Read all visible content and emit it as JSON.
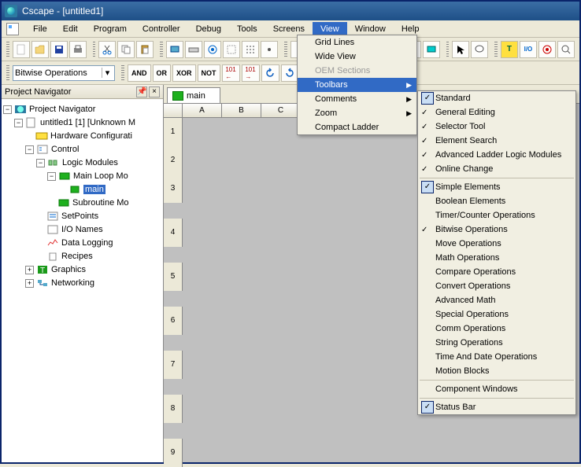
{
  "window_title": "Cscape - [untitled1]",
  "menubar": [
    "File",
    "Edit",
    "Program",
    "Controller",
    "Debug",
    "Tools",
    "Screens",
    "View",
    "Window",
    "Help"
  ],
  "active_menu": "View",
  "toolbar2_combo": "Bitwise Operations",
  "toolbar2_txtbtns": [
    "AND",
    "OR",
    "XOR",
    "NOT"
  ],
  "navigator_title": "Project Navigator",
  "tree": {
    "root": "Project Navigator",
    "project": "untitled1 [1] [Unknown M",
    "hw": "Hardware Configurati",
    "control": "Control",
    "logic": "Logic Modules",
    "mainloop": "Main Loop Mo",
    "main": "main",
    "subroutine": "Subroutine Mo",
    "setpoints": "SetPoints",
    "ionames": "I/O Names",
    "datalog": "Data Logging",
    "recipes": "Recipes",
    "graphics": "Graphics",
    "networking": "Networking"
  },
  "tab_label": "main",
  "col_labels": [
    "A",
    "B",
    "C"
  ],
  "row_nums": [
    "1",
    "2",
    "3",
    "4",
    "5",
    "6",
    "7",
    "8",
    "9"
  ],
  "view_menu_items": [
    {
      "label": "Grid Lines"
    },
    {
      "label": "Wide View"
    },
    {
      "label": "OEM Sections",
      "disabled": true
    },
    {
      "label": "Toolbars",
      "submenu": true,
      "highlight": true
    },
    {
      "label": "Comments",
      "submenu": true
    },
    {
      "label": "Zoom",
      "submenu": true
    },
    {
      "label": "Compact Ladder"
    }
  ],
  "toolbars_items": [
    {
      "label": "Standard",
      "checked": true,
      "boxed": true
    },
    {
      "label": "General Editing",
      "checked": true
    },
    {
      "label": "Selector Tool",
      "checked": true
    },
    {
      "label": "Element Search",
      "checked": true
    },
    {
      "label": "Advanced Ladder Logic Modules",
      "checked": true
    },
    {
      "label": "Online Change",
      "checked": true
    },
    {
      "sep": true
    },
    {
      "label": "Simple Elements",
      "checked": true,
      "boxed": true
    },
    {
      "label": "Boolean Elements"
    },
    {
      "label": "Timer/Counter Operations"
    },
    {
      "label": "Bitwise Operations",
      "checked": true
    },
    {
      "label": "Move Operations"
    },
    {
      "label": "Math Operations"
    },
    {
      "label": "Compare Operations"
    },
    {
      "label": "Convert Operations"
    },
    {
      "label": "Advanced Math"
    },
    {
      "label": "Special Operations"
    },
    {
      "label": "Comm Operations"
    },
    {
      "label": "String Operations"
    },
    {
      "label": "Time And Date Operations"
    },
    {
      "label": "Motion Blocks"
    },
    {
      "sep": true
    },
    {
      "label": "Component Windows"
    },
    {
      "sep": true
    },
    {
      "label": "Status Bar",
      "checked": true,
      "boxed": true
    }
  ]
}
